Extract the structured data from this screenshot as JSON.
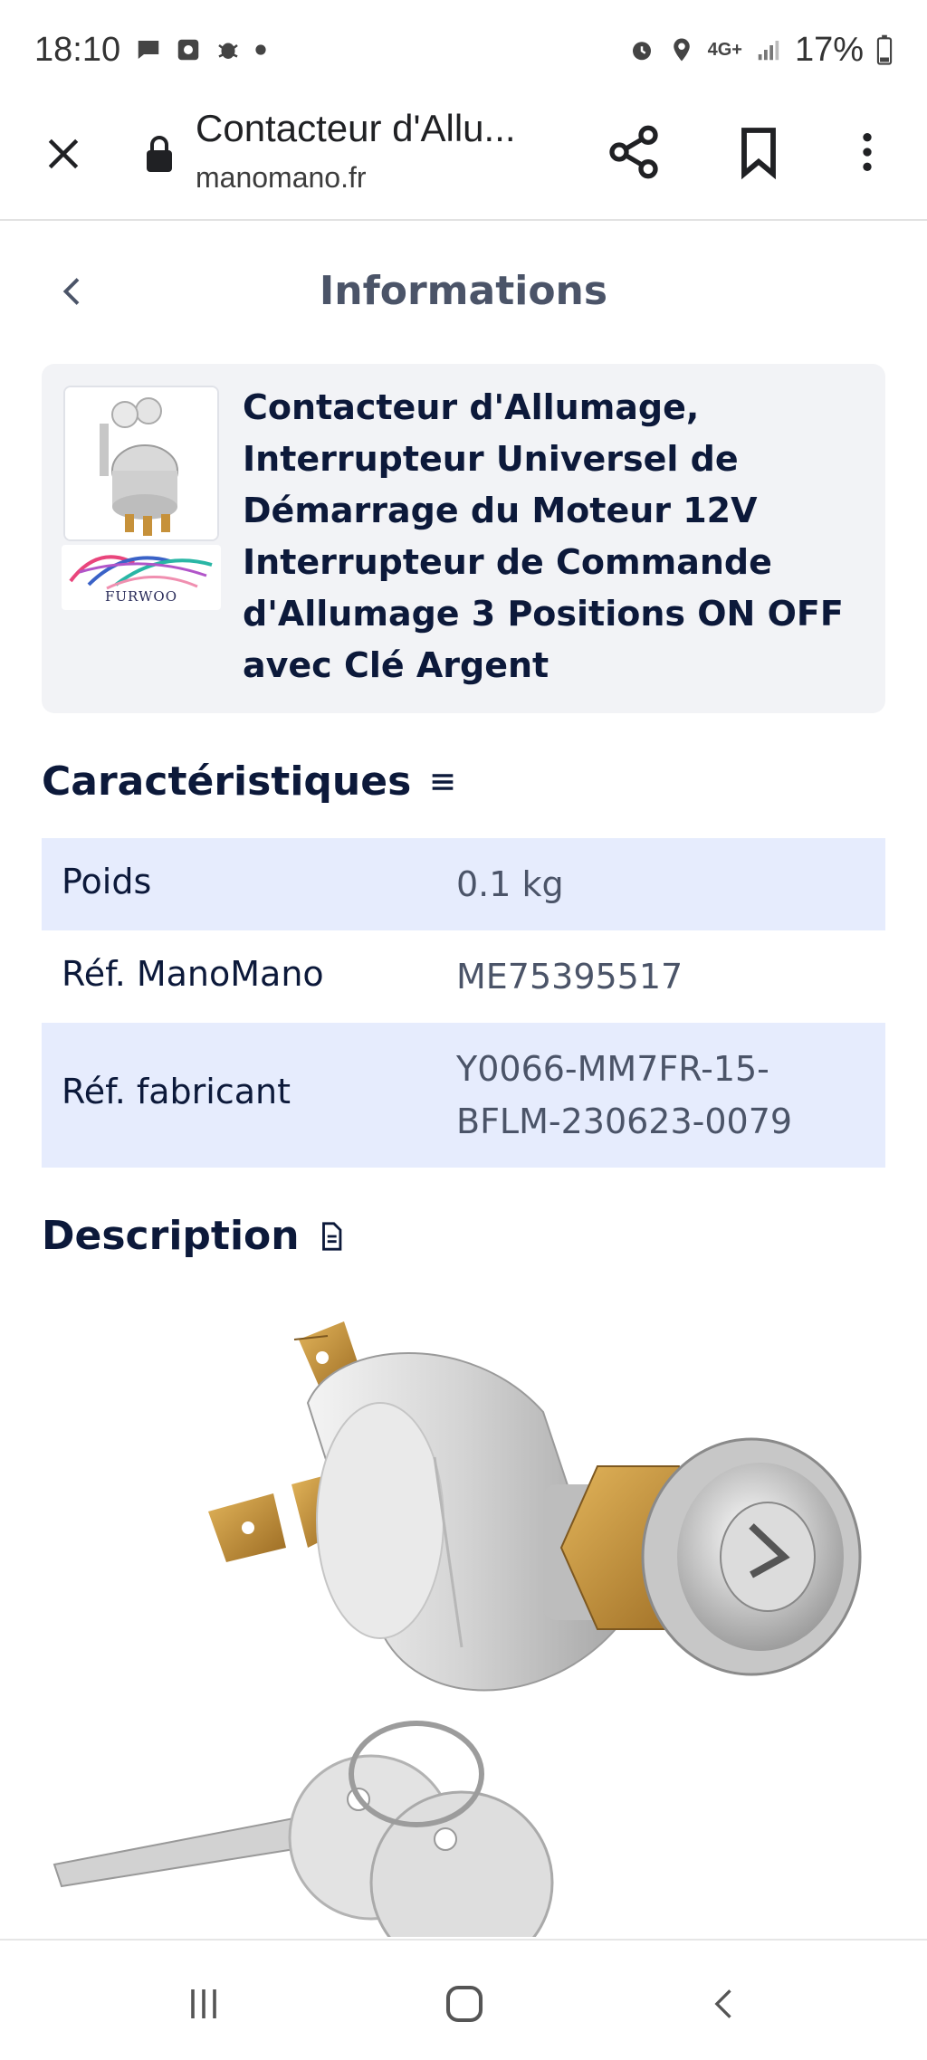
{
  "status_bar": {
    "time": "18:10",
    "battery": "17%",
    "network": "4G+",
    "icons": [
      "chat-icon",
      "photo-icon",
      "bug-icon",
      "dot-icon",
      "alarm-icon",
      "location-icon",
      "network-icon",
      "signal-icon",
      "battery-icon"
    ]
  },
  "browser": {
    "page_title": "Contacteur d'Allu...",
    "url": "manomano.fr",
    "icons": [
      "close-icon",
      "lock-icon",
      "share-icon",
      "bookmark-icon",
      "more-icon"
    ]
  },
  "header": {
    "title": "Informations"
  },
  "product": {
    "name": "Contacteur d'Allumage, Interrupteur Universel de Démarrage du Moteur 12V Interrupteur de Commande d'Allumage 3 Positions ON OFF avec Clé Argent",
    "brand": "FURWOO"
  },
  "specs": {
    "heading": "Caractéristiques",
    "rows": [
      {
        "label": "Poids",
        "value": "0.1 kg"
      },
      {
        "label": "Réf. ManoMano",
        "value": "ME75395517"
      },
      {
        "label": "Réf. fabricant",
        "value": "Y0066-MM7FR-15-BFLM-230623-0079"
      }
    ]
  },
  "description": {
    "heading": "Description"
  },
  "colors": {
    "navy": "#0c193a",
    "muted": "#4b5468",
    "row_shade": "#e6ecfd",
    "card_bg": "#f2f3f6"
  }
}
